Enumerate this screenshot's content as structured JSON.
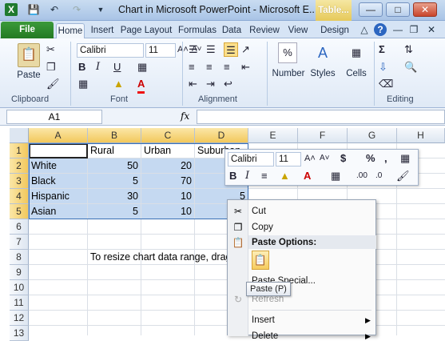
{
  "title_bar": {
    "title": "Chart in Microsoft PowerPoint - Microsoft E...",
    "context_tab": "Table...",
    "icons": [
      "excel-logo-icon",
      "save-icon",
      "undo-icon",
      "redo-icon",
      "customize-qat-icon"
    ]
  },
  "tabs": [
    "File",
    "Home",
    "Insert",
    "Page Layout",
    "Formulas",
    "Data",
    "Review",
    "View",
    "Design"
  ],
  "ribbon": {
    "clipboard": {
      "paste_label": "Paste",
      "group_label": "Clipboard"
    },
    "font": {
      "font_name": "Calibri",
      "font_size": "11",
      "group_label": "Font"
    },
    "alignment": {
      "group_label": "Alignment"
    },
    "number": {
      "label": "Number",
      "symbol": "%"
    },
    "styles": {
      "label": "Styles"
    },
    "cells": {
      "label": "Cells"
    },
    "editing": {
      "group_label": "Editing"
    }
  },
  "formula_bar": {
    "name_box": "A1",
    "fx": "fx",
    "content": ""
  },
  "columns": [
    "A",
    "B",
    "C",
    "D",
    "E",
    "F",
    "G",
    "H"
  ],
  "rows": [
    "1",
    "2",
    "3",
    "4",
    "5",
    "6",
    "7",
    "8",
    "9",
    "10",
    "11",
    "12",
    "13"
  ],
  "cells": {
    "b1": "Rural",
    "c1": "Urban",
    "d1": "Suburban",
    "a2": "White",
    "b2": "50",
    "c2": "20",
    "a3": "Black",
    "b3": "5",
    "c3": "70",
    "a4": "Hispanic",
    "b4": "30",
    "c4": "10",
    "d4": "5",
    "a5": "Asian",
    "b5": "5",
    "c5": "10",
    "b8": "To resize chart data range, drag lower right corner of range."
  },
  "mini_toolbar": {
    "font_name": "Calibri",
    "font_size": "11",
    "currency": "$",
    "percent": "%",
    "comma": ","
  },
  "context_menu": {
    "cut": "Cut",
    "copy": "Copy",
    "paste_options": "Paste Options:",
    "paste_special": "Paste Special...",
    "refresh": "Refresh",
    "insert": "Insert",
    "delete": "Delete"
  },
  "tooltip": "Paste (P)"
}
